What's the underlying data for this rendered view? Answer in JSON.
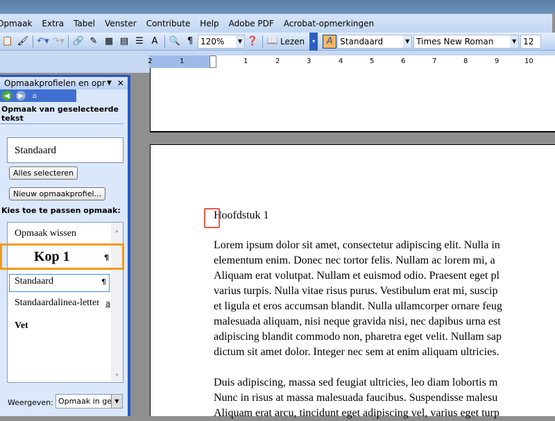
{
  "menu": [
    "Opmaak",
    "Extra",
    "Tabel",
    "Venster",
    "Contribute",
    "Help",
    "Adobe PDF",
    "Acrobat-opmerkingen"
  ],
  "toolbar": {
    "zoom": "120%",
    "read": "Lezen",
    "style": "Standaard",
    "font": "Times New Roman",
    "size": "12",
    "pilcrow": "¶"
  },
  "ruler": [
    "2",
    "1",
    "1",
    "2",
    "3",
    "4",
    "5",
    "6",
    "7",
    "8",
    "9",
    "10"
  ],
  "panel": {
    "title": "Opmaakprofielen en opmaak",
    "section1": "Opmaak van geselecteerde tekst",
    "current": "Standaard",
    "select_all": "Alles selecteren",
    "new_style": "Nieuw opmaakprofiel...",
    "section2": "Kies toe te passen opmaak:",
    "items": [
      {
        "label": "Opmaak wissen",
        "mark": ""
      },
      {
        "label": "Kop 1",
        "mark": "¶"
      },
      {
        "label": "Standaard",
        "mark": "¶"
      },
      {
        "label": "Standaardalinea-lettertype",
        "mark": "a"
      },
      {
        "label": "Vet",
        "mark": ""
      }
    ],
    "show_label": "Weergeven:",
    "show_value": "Opmaak in gebruik"
  },
  "document": {
    "heading": "Hoofdstuk 1",
    "para1": [
      "Lorem ipsum dolor sit amet, consectetur adipiscing elit. Nulla in",
      "elementum enim. Donec nec tortor felis. Nullam ac lorem mi, a",
      "Aliquam erat volutpat. Nullam et euismod odio. Praesent eget pl",
      "varius turpis. Nulla vitae risus purus. Vestibulum erat mi, suscip",
      "et ligula et eros accumsan blandit. Nulla ullamcorper ornare feug",
      "malesuada aliquam, nisi neque gravida nisi, nec dapibus urna est",
      "adipiscing blandit commodo non, pharetra eget velit. Nullam sap",
      "dictum sit amet dolor. Integer nec sem at enim aliquam ultricies."
    ],
    "para2": [
      "Duis adipiscing, massa sed feugiat ultricies, leo diam lobortis m",
      "Nunc in risus at massa malesuada faucibus. Suspendisse malesu",
      "Aliquam erat arcu, tincidunt eget adipiscing vel, varius eget turp"
    ]
  },
  "colors": {
    "highlight": "#f29a10",
    "cursor_box": "#e55a4a",
    "panel_border": "#2458c8"
  }
}
